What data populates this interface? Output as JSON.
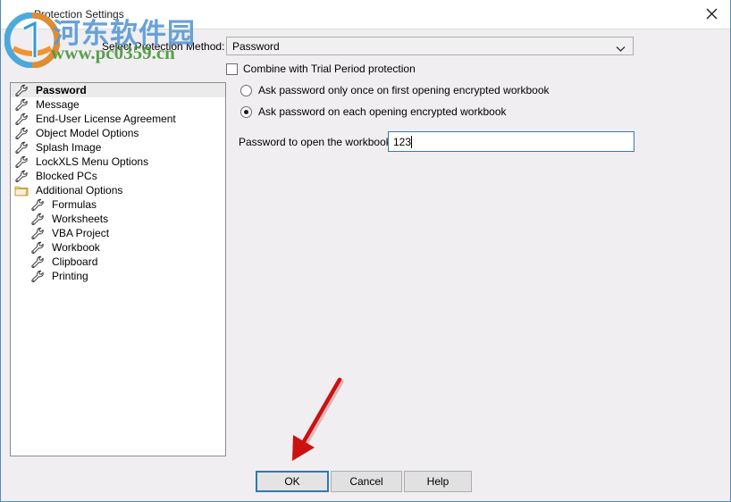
{
  "window": {
    "title": "Protection Settings",
    "close_icon": "close-icon",
    "accent_color": "#4a90b8",
    "background_color": "#f0eef1"
  },
  "watermark": {
    "logo_icon": "site-logo-icon",
    "brand_cn": "河东软件园",
    "url": "www.pc0359.cn",
    "brand_color": "#5b9bd5",
    "url_color": "#4a9a3c"
  },
  "tree": {
    "items": [
      {
        "label": "Password",
        "icon": "wrench-icon",
        "level": 0,
        "selected": true
      },
      {
        "label": "Message",
        "icon": "wrench-icon",
        "level": 0,
        "selected": false
      },
      {
        "label": "End-User License Agreement",
        "icon": "wrench-icon",
        "level": 0,
        "selected": false
      },
      {
        "label": "Object Model Options",
        "icon": "wrench-icon",
        "level": 0,
        "selected": false
      },
      {
        "label": "Splash Image",
        "icon": "wrench-icon",
        "level": 0,
        "selected": false
      },
      {
        "label": "LockXLS Menu Options",
        "icon": "wrench-icon",
        "level": 0,
        "selected": false
      },
      {
        "label": "Blocked PCs",
        "icon": "wrench-icon",
        "level": 0,
        "selected": false
      },
      {
        "label": "Additional Options",
        "icon": "folder-icon",
        "level": 0,
        "selected": false
      },
      {
        "label": "Formulas",
        "icon": "wrench-icon",
        "level": 1,
        "selected": false
      },
      {
        "label": "Worksheets",
        "icon": "wrench-icon",
        "level": 1,
        "selected": false
      },
      {
        "label": "VBA Project",
        "icon": "wrench-icon",
        "level": 1,
        "selected": false
      },
      {
        "label": "Workbook",
        "icon": "wrench-icon",
        "level": 1,
        "selected": false
      },
      {
        "label": "Clipboard",
        "icon": "wrench-icon",
        "level": 1,
        "selected": false
      },
      {
        "label": "Printing",
        "icon": "wrench-icon",
        "level": 1,
        "selected": false
      }
    ]
  },
  "form": {
    "select_label": "Select Protection Method:",
    "method_value": "Password",
    "method_options": [
      "Password"
    ],
    "method_arrow_icon": "chevron-down-icon",
    "combine_checkbox_label": "Combine with Trial Period protection",
    "combine_checked": false,
    "radio_once_label": "Ask password only once on first opening encrypted workbook",
    "radio_once_selected": false,
    "radio_each_label": "Ask password on each opening encrypted workbook",
    "radio_each_selected": true,
    "password_label": "Password to open the workbook:",
    "password_value": "123",
    "password_placeholder": ""
  },
  "buttons": {
    "ok": "OK",
    "cancel": "Cancel",
    "help": "Help"
  },
  "annotation": {
    "arrow_color": "#cc1111",
    "arrow_target": "ok-button"
  }
}
